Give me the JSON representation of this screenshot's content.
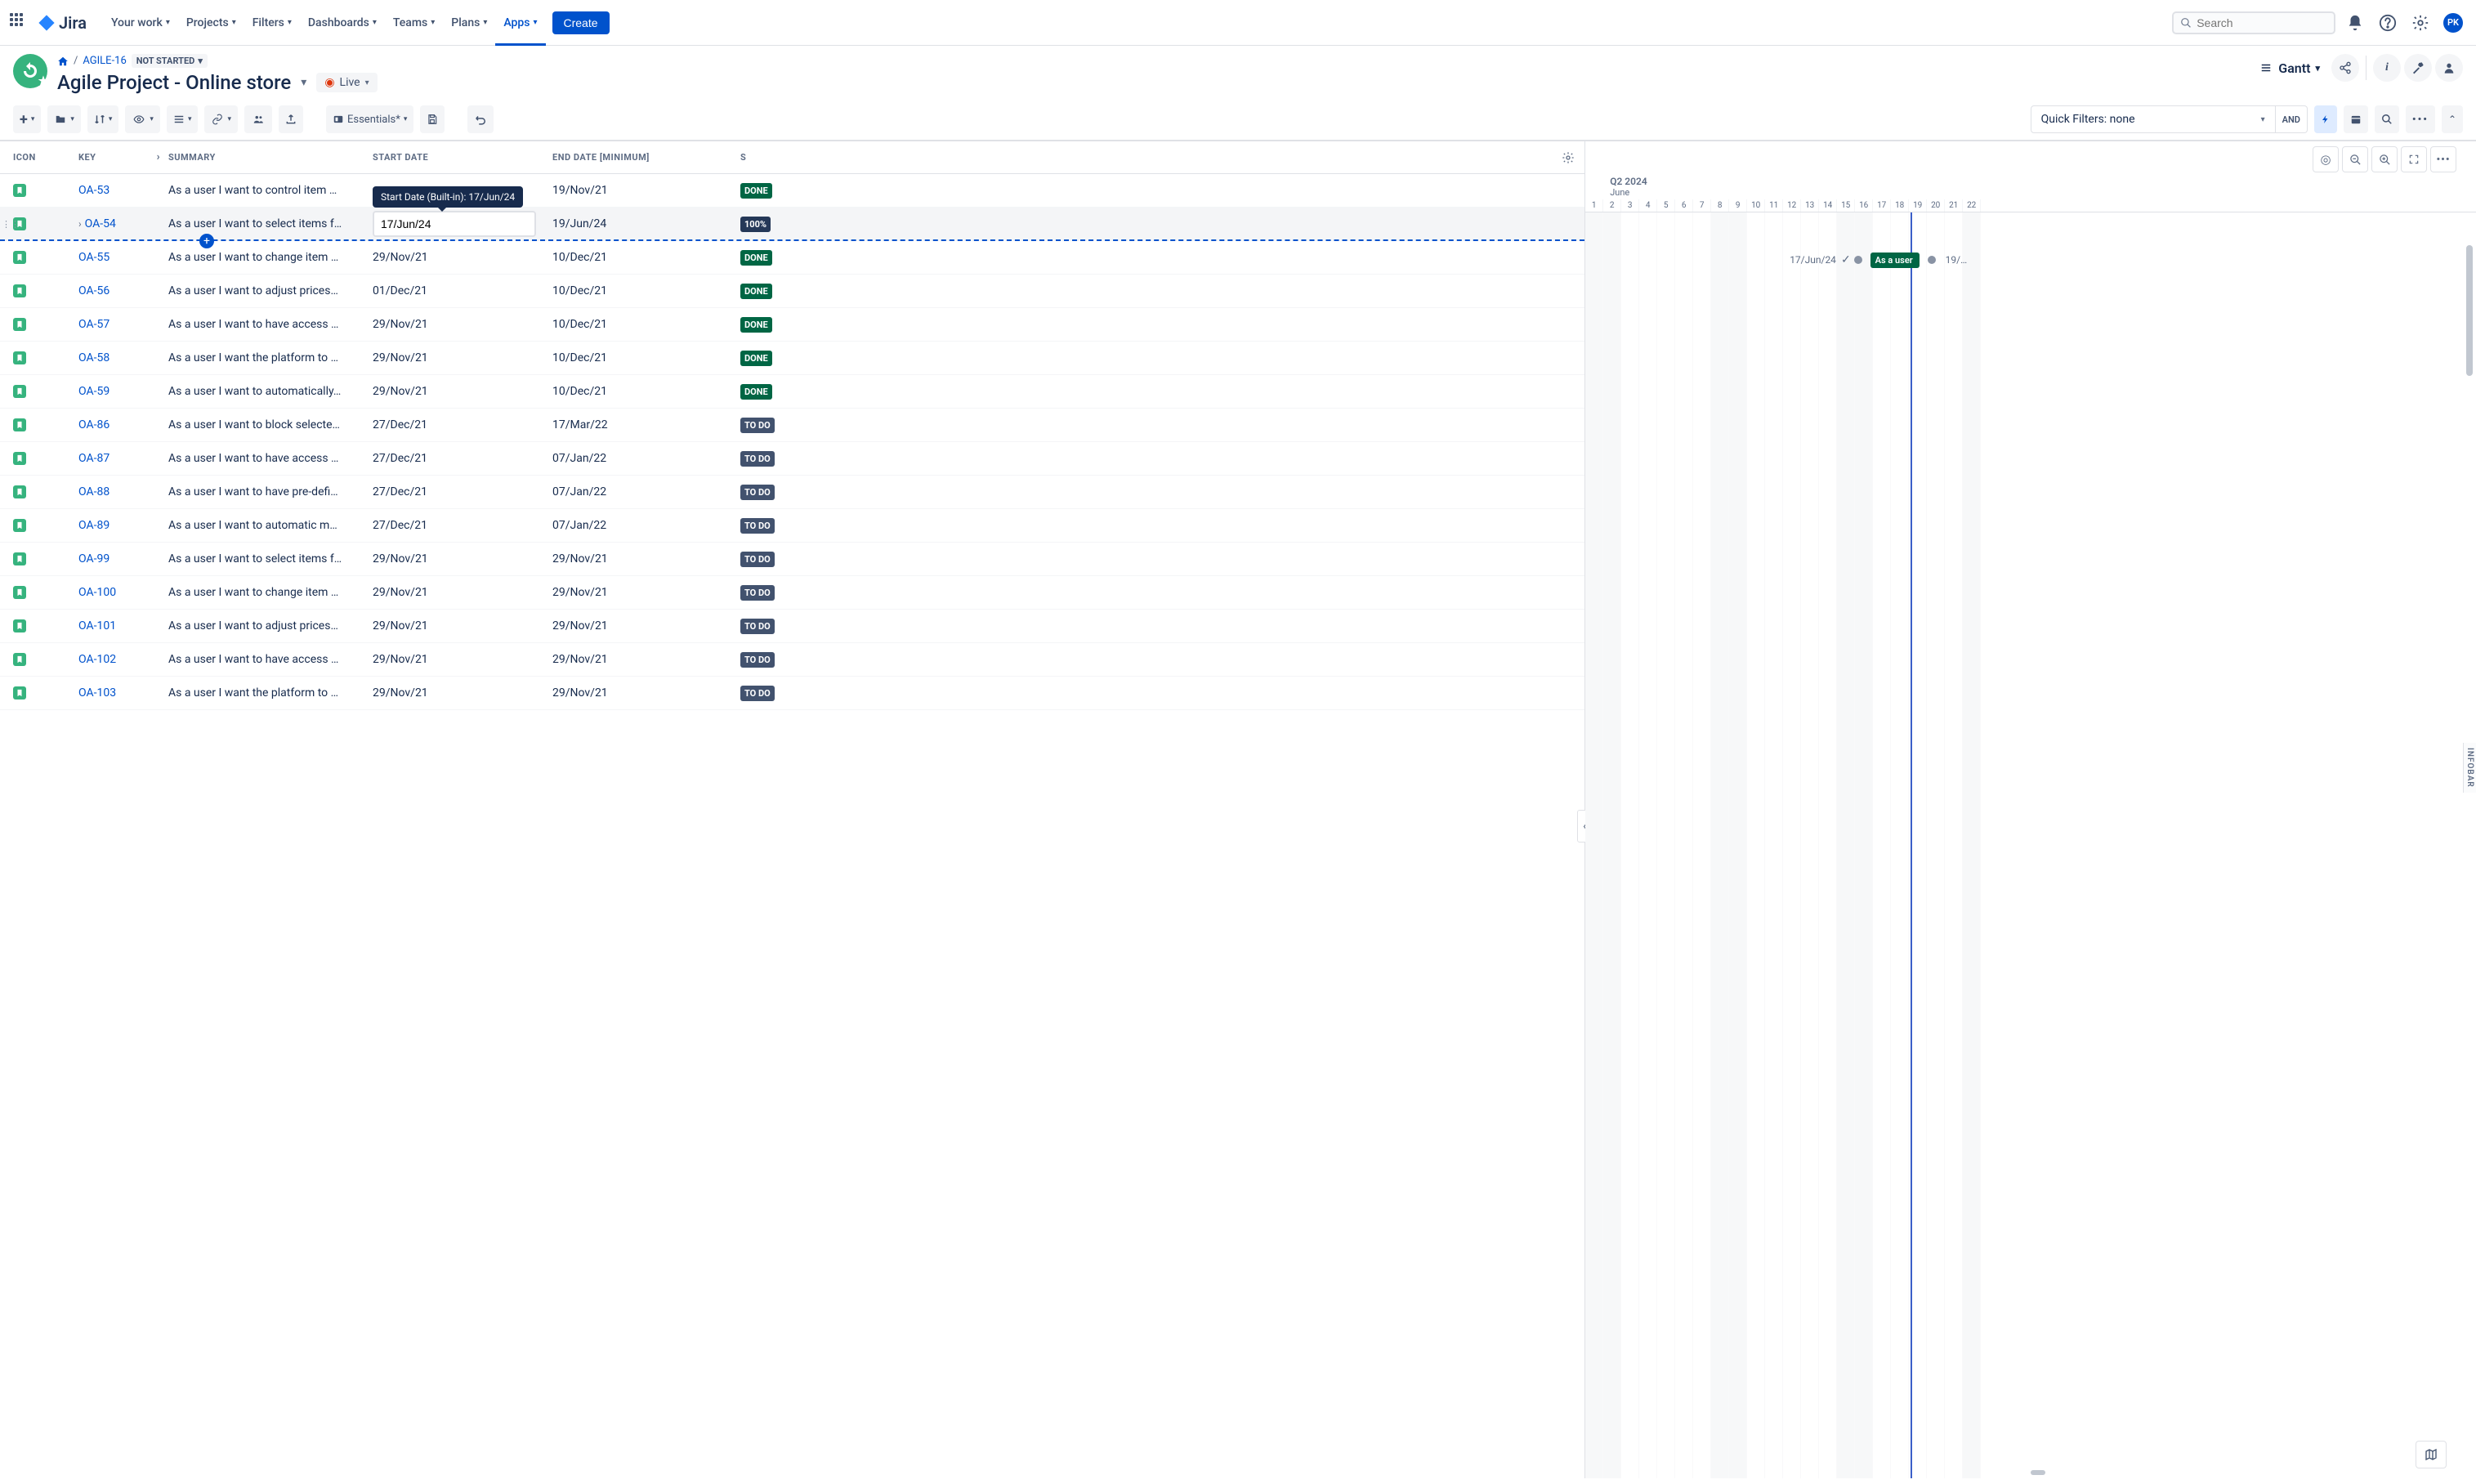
{
  "nav": {
    "items": [
      "Your work",
      "Projects",
      "Filters",
      "Dashboards",
      "Teams",
      "Plans",
      "Apps"
    ],
    "create": "Create",
    "search_placeholder": "Search",
    "avatar": "PK"
  },
  "header": {
    "breadcrumb_key": "AGILE-16",
    "status": "NOT STARTED",
    "title": "Agile Project - Online store",
    "live": "Live",
    "view_mode": "Gantt"
  },
  "toolbar": {
    "essentials": "Essentials*",
    "quick_filters": "Quick Filters: none",
    "and": "AND"
  },
  "columns": {
    "icon": "ICON",
    "key": "KEY",
    "summary": "SUMMARY",
    "start": "START DATE",
    "end": "END DATE [MINIMUM]",
    "status": "S"
  },
  "tooltip": "Start Date (Built-in): 17/Jun/24",
  "rows": [
    {
      "key": "OA-53",
      "summary": "As a user I want to control item …",
      "start": "",
      "end": "19/Nov/21",
      "status": "DONE",
      "statusClass": "done"
    },
    {
      "key": "OA-54",
      "summary": "As a user I want to select items f…",
      "start": "17/Jun/24",
      "end": "19/Jun/24",
      "status": "100%",
      "statusClass": "pct",
      "selected": true,
      "editing": true,
      "expandable": true
    },
    {
      "key": "OA-55",
      "summary": "As a user I want to change item …",
      "start": "29/Nov/21",
      "end": "10/Dec/21",
      "status": "DONE",
      "statusClass": "done"
    },
    {
      "key": "OA-56",
      "summary": "As a user I want to adjust prices…",
      "start": "01/Dec/21",
      "end": "10/Dec/21",
      "status": "DONE",
      "statusClass": "done"
    },
    {
      "key": "OA-57",
      "summary": "As a user I want to have access …",
      "start": "29/Nov/21",
      "end": "10/Dec/21",
      "status": "DONE",
      "statusClass": "done"
    },
    {
      "key": "OA-58",
      "summary": "As a user I want the platform to …",
      "start": "29/Nov/21",
      "end": "10/Dec/21",
      "status": "DONE",
      "statusClass": "done"
    },
    {
      "key": "OA-59",
      "summary": "As a user I want to automatically…",
      "start": "29/Nov/21",
      "end": "10/Dec/21",
      "status": "DONE",
      "statusClass": "done"
    },
    {
      "key": "OA-86",
      "summary": "As a user I want to block selecte…",
      "start": "27/Dec/21",
      "end": "17/Mar/22",
      "status": "TO DO",
      "statusClass": "navy"
    },
    {
      "key": "OA-87",
      "summary": "As a user I want to have access …",
      "start": "27/Dec/21",
      "end": "07/Jan/22",
      "status": "TO DO",
      "statusClass": "navy"
    },
    {
      "key": "OA-88",
      "summary": "As a user I want to have pre-defi…",
      "start": "27/Dec/21",
      "end": "07/Jan/22",
      "status": "TO DO",
      "statusClass": "navy"
    },
    {
      "key": "OA-89",
      "summary": "As a user I want to automatic m…",
      "start": "27/Dec/21",
      "end": "07/Jan/22",
      "status": "TO DO",
      "statusClass": "navy"
    },
    {
      "key": "OA-99",
      "summary": "As a user I want to select items f…",
      "start": "29/Nov/21",
      "end": "29/Nov/21",
      "status": "TO DO",
      "statusClass": "navy"
    },
    {
      "key": "OA-100",
      "summary": "As a user I want to change item …",
      "start": "29/Nov/21",
      "end": "29/Nov/21",
      "status": "TO DO",
      "statusClass": "navy"
    },
    {
      "key": "OA-101",
      "summary": "As a user I want to adjust prices…",
      "start": "29/Nov/21",
      "end": "29/Nov/21",
      "status": "TO DO",
      "statusClass": "navy"
    },
    {
      "key": "OA-102",
      "summary": "As a user I want to have access …",
      "start": "29/Nov/21",
      "end": "29/Nov/21",
      "status": "TO DO",
      "statusClass": "navy"
    },
    {
      "key": "OA-103",
      "summary": "As a user I want the platform to …",
      "start": "29/Nov/21",
      "end": "29/Nov/21",
      "status": "TO DO",
      "statusClass": "navy"
    }
  ],
  "gantt": {
    "quarter": "Q2 2024",
    "month": "June",
    "days": [
      "1",
      "2",
      "3",
      "4",
      "5",
      "6",
      "7",
      "8",
      "9",
      "10",
      "11",
      "12",
      "13",
      "14",
      "15",
      "16",
      "17",
      "18",
      "19",
      "20",
      "21",
      "22"
    ],
    "weekends": [
      0,
      1,
      7,
      8,
      14,
      15,
      21
    ],
    "bar_label_left": "17/Jun/24",
    "bar_text": "As a user",
    "bar_label_right": "19/…",
    "infobar": "INFOBAR"
  }
}
